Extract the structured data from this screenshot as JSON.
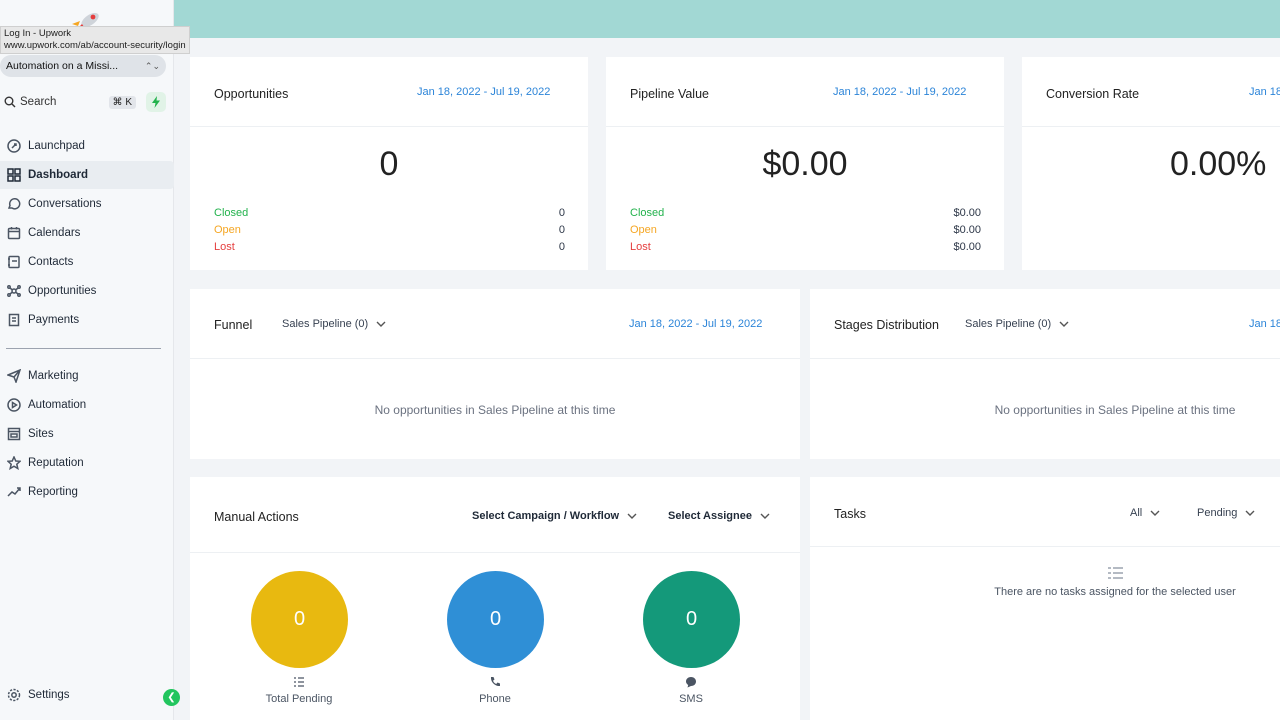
{
  "tooltip": {
    "title": "Log In - Upwork",
    "url": "www.upwork.com/ab/account-security/login"
  },
  "sidebar": {
    "account": "Automation on a Missi...",
    "search_label": "Search",
    "search_shortcut": "⌘ K",
    "items": [
      {
        "label": "Launchpad",
        "icon": "rocket-icon"
      },
      {
        "label": "Dashboard",
        "icon": "grid-icon",
        "active": true
      },
      {
        "label": "Conversations",
        "icon": "chat-icon"
      },
      {
        "label": "Calendars",
        "icon": "calendar-icon"
      },
      {
        "label": "Contacts",
        "icon": "contacts-icon"
      },
      {
        "label": "Opportunities",
        "icon": "network-icon"
      },
      {
        "label": "Payments",
        "icon": "receipt-icon"
      },
      {
        "label": "Marketing",
        "icon": "send-icon"
      },
      {
        "label": "Automation",
        "icon": "automation-icon"
      },
      {
        "label": "Sites",
        "icon": "sites-icon"
      },
      {
        "label": "Reputation",
        "icon": "star-icon"
      },
      {
        "label": "Reporting",
        "icon": "trend-icon"
      }
    ],
    "settings_label": "Settings"
  },
  "opportunities": {
    "title": "Opportunities",
    "date_range": "Jan 18, 2022 - Jul 19, 2022",
    "total": "0",
    "rows": [
      {
        "label": "Closed",
        "value": "0"
      },
      {
        "label": "Open",
        "value": "0"
      },
      {
        "label": "Lost",
        "value": "0"
      }
    ]
  },
  "pipeline_value": {
    "title": "Pipeline Value",
    "date_range": "Jan 18, 2022 - Jul 19, 2022",
    "total": "$0.00",
    "rows": [
      {
        "label": "Closed",
        "value": "$0.00"
      },
      {
        "label": "Open",
        "value": "$0.00"
      },
      {
        "label": "Lost",
        "value": "$0.00"
      }
    ]
  },
  "conversion_rate": {
    "title": "Conversion Rate",
    "date_range": "Jan 18",
    "total": "0.00%"
  },
  "funnel": {
    "title": "Funnel",
    "pipeline_select": "Sales Pipeline (0)",
    "date_range": "Jan 18, 2022 - Jul 19, 2022",
    "empty": "No opportunities in Sales Pipeline at this time"
  },
  "stages": {
    "title": "Stages Distribution",
    "pipeline_select": "Sales Pipeline (0)",
    "date_range": "Jan 18",
    "empty": "No opportunities in Sales Pipeline at this time"
  },
  "manual_actions": {
    "title": "Manual Actions",
    "campaign_select": "Select Campaign / Workflow",
    "assignee_select": "Select Assignee",
    "stats": [
      {
        "label": "Total Pending",
        "value": "0",
        "color": "#e8b910",
        "icon": "checklist-icon"
      },
      {
        "label": "Phone",
        "value": "0",
        "color": "#2f8fd6",
        "icon": "phone-icon"
      },
      {
        "label": "SMS",
        "value": "0",
        "color": "#14997a",
        "icon": "sms-icon"
      }
    ]
  },
  "tasks": {
    "title": "Tasks",
    "filter_all": "All",
    "filter_status": "Pending",
    "empty": "There are no tasks assigned for the selected user"
  },
  "colors": {
    "topbar": "#a2d8d4",
    "accent_link": "#2b84d8",
    "closed": "#22b24c",
    "open": "#f5a623",
    "lost": "#e53e3e"
  }
}
